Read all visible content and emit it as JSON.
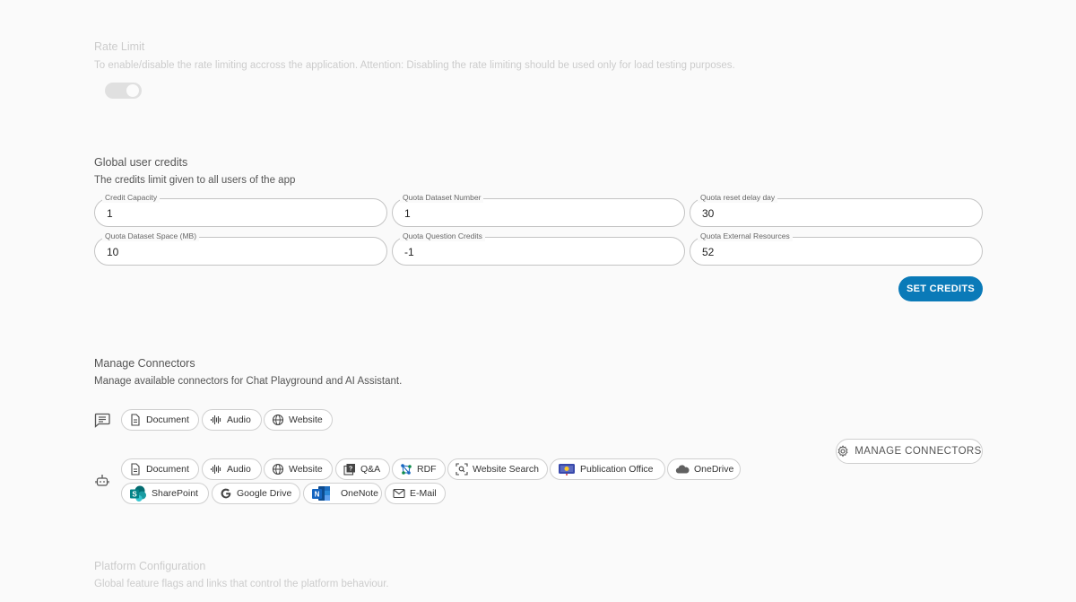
{
  "rate_limit": {
    "title": "Rate Limit",
    "description": "To enable/disable the rate limiting accross the application. Attention: Disabling the rate limiting should be used only for load testing purposes.",
    "enabled": true
  },
  "credits": {
    "title": "Global user credits",
    "description": "The credits limit given to all users of the app",
    "fields": [
      {
        "label": "Credit Capacity",
        "value": "1"
      },
      {
        "label": "Quota Dataset Number",
        "value": "1"
      },
      {
        "label": "Quota reset delay day",
        "value": "30"
      },
      {
        "label": "Quota Dataset Space (MB)",
        "value": "10"
      },
      {
        "label": "Quota Question Credits",
        "value": "-1"
      },
      {
        "label": "Quota External Resources",
        "value": "52"
      }
    ],
    "button_label": "SET CREDITS"
  },
  "connectors": {
    "title": "Manage Connectors",
    "description": "Manage available connectors for Chat Playground and AI Assistant.",
    "manage_button_label": "MANAGE CONNECTORS",
    "chat_playground": [
      {
        "label": "Document",
        "icon": "document-icon"
      },
      {
        "label": "Audio",
        "icon": "audio-icon"
      },
      {
        "label": "Website",
        "icon": "globe-icon"
      }
    ],
    "ai_assistant": [
      {
        "label": "Document",
        "icon": "document-icon"
      },
      {
        "label": "Audio",
        "icon": "audio-icon"
      },
      {
        "label": "Website",
        "icon": "globe-icon"
      },
      {
        "label": "Q&A",
        "icon": "qa-icon"
      },
      {
        "label": "RDF",
        "icon": "rdf-icon"
      },
      {
        "label": "Website Search",
        "icon": "web-search-icon"
      },
      {
        "label": "Publication Office",
        "icon": "publication-office-icon"
      },
      {
        "label": "OneDrive",
        "icon": "onedrive-icon"
      },
      {
        "label": "SharePoint",
        "icon": "sharepoint-icon"
      },
      {
        "label": "Google Drive",
        "icon": "google-drive-icon"
      },
      {
        "label": "OneNote",
        "icon": "onenote-icon"
      },
      {
        "label": "E-Mail",
        "icon": "email-icon"
      }
    ]
  },
  "platform": {
    "title": "Platform Configuration",
    "description": "Global feature flags and links that control the platform behaviour."
  },
  "colors": {
    "primary": "#0a7ab8",
    "background": "#fafafa"
  }
}
